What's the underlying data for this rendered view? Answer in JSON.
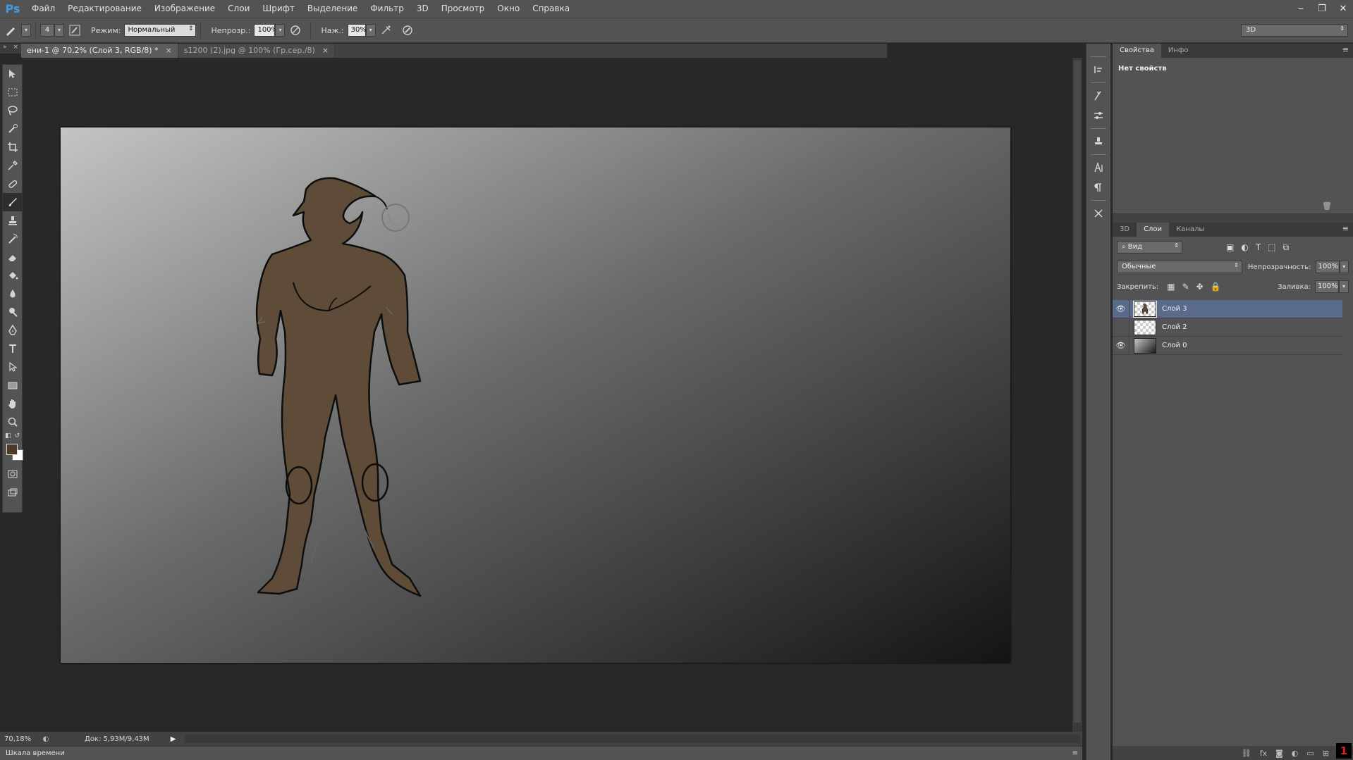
{
  "app": {
    "logo": "Ps"
  },
  "menu": [
    "Файл",
    "Редактирование",
    "Изображение",
    "Слои",
    "Шрифт",
    "Выделение",
    "Фильтр",
    "3D",
    "Просмотр",
    "Окно",
    "Справка"
  ],
  "window_controls": {
    "minimize": "‒",
    "restore": "❐",
    "close": "✕"
  },
  "options": {
    "brush_size": "4",
    "mode_label": "Режим:",
    "mode_value": "Нормальный",
    "opacity_label": "Непрозр.:",
    "opacity_value": "100%",
    "flow_label": "Наж.:",
    "flow_value": "30%",
    "workspace": "3D"
  },
  "tabs": [
    {
      "title": "ени-1 @ 70,2% (Слой 3, RGB/8) *",
      "close": "×"
    },
    {
      "title": "s1200 (2).jpg @ 100% (Гр.сер./8)",
      "close": "×"
    }
  ],
  "status": {
    "zoom": "70,18%",
    "doc": "Док: 5,93M/9,43M",
    "timeline": "Шкала времени"
  },
  "properties": {
    "tabs": [
      "Свойства",
      "Инфо"
    ],
    "body": "Нет свойств"
  },
  "layers": {
    "tabs": [
      "3D",
      "Слои",
      "Каналы"
    ],
    "kind": "Вид",
    "blend": "Обычные",
    "opacity_label": "Непрозрачность:",
    "opacity_value": "100%",
    "lock_label": "Закрепить:",
    "fill_label": "Заливка:",
    "fill_value": "100%",
    "items": [
      {
        "name": "Слой 3",
        "visible": true,
        "selected": true
      },
      {
        "name": "Слой 2",
        "visible": false,
        "selected": false
      },
      {
        "name": "Слой 0",
        "visible": true,
        "selected": false
      }
    ]
  },
  "colors": {
    "foreground": "#4a3a2a",
    "background": "#ffffff",
    "figure_fill": "#5e4b38",
    "canvas_gradient_start": "#c4c4c4",
    "canvas_gradient_end": "#141414",
    "accent": "#3d9be9"
  },
  "corner_badge": "1"
}
